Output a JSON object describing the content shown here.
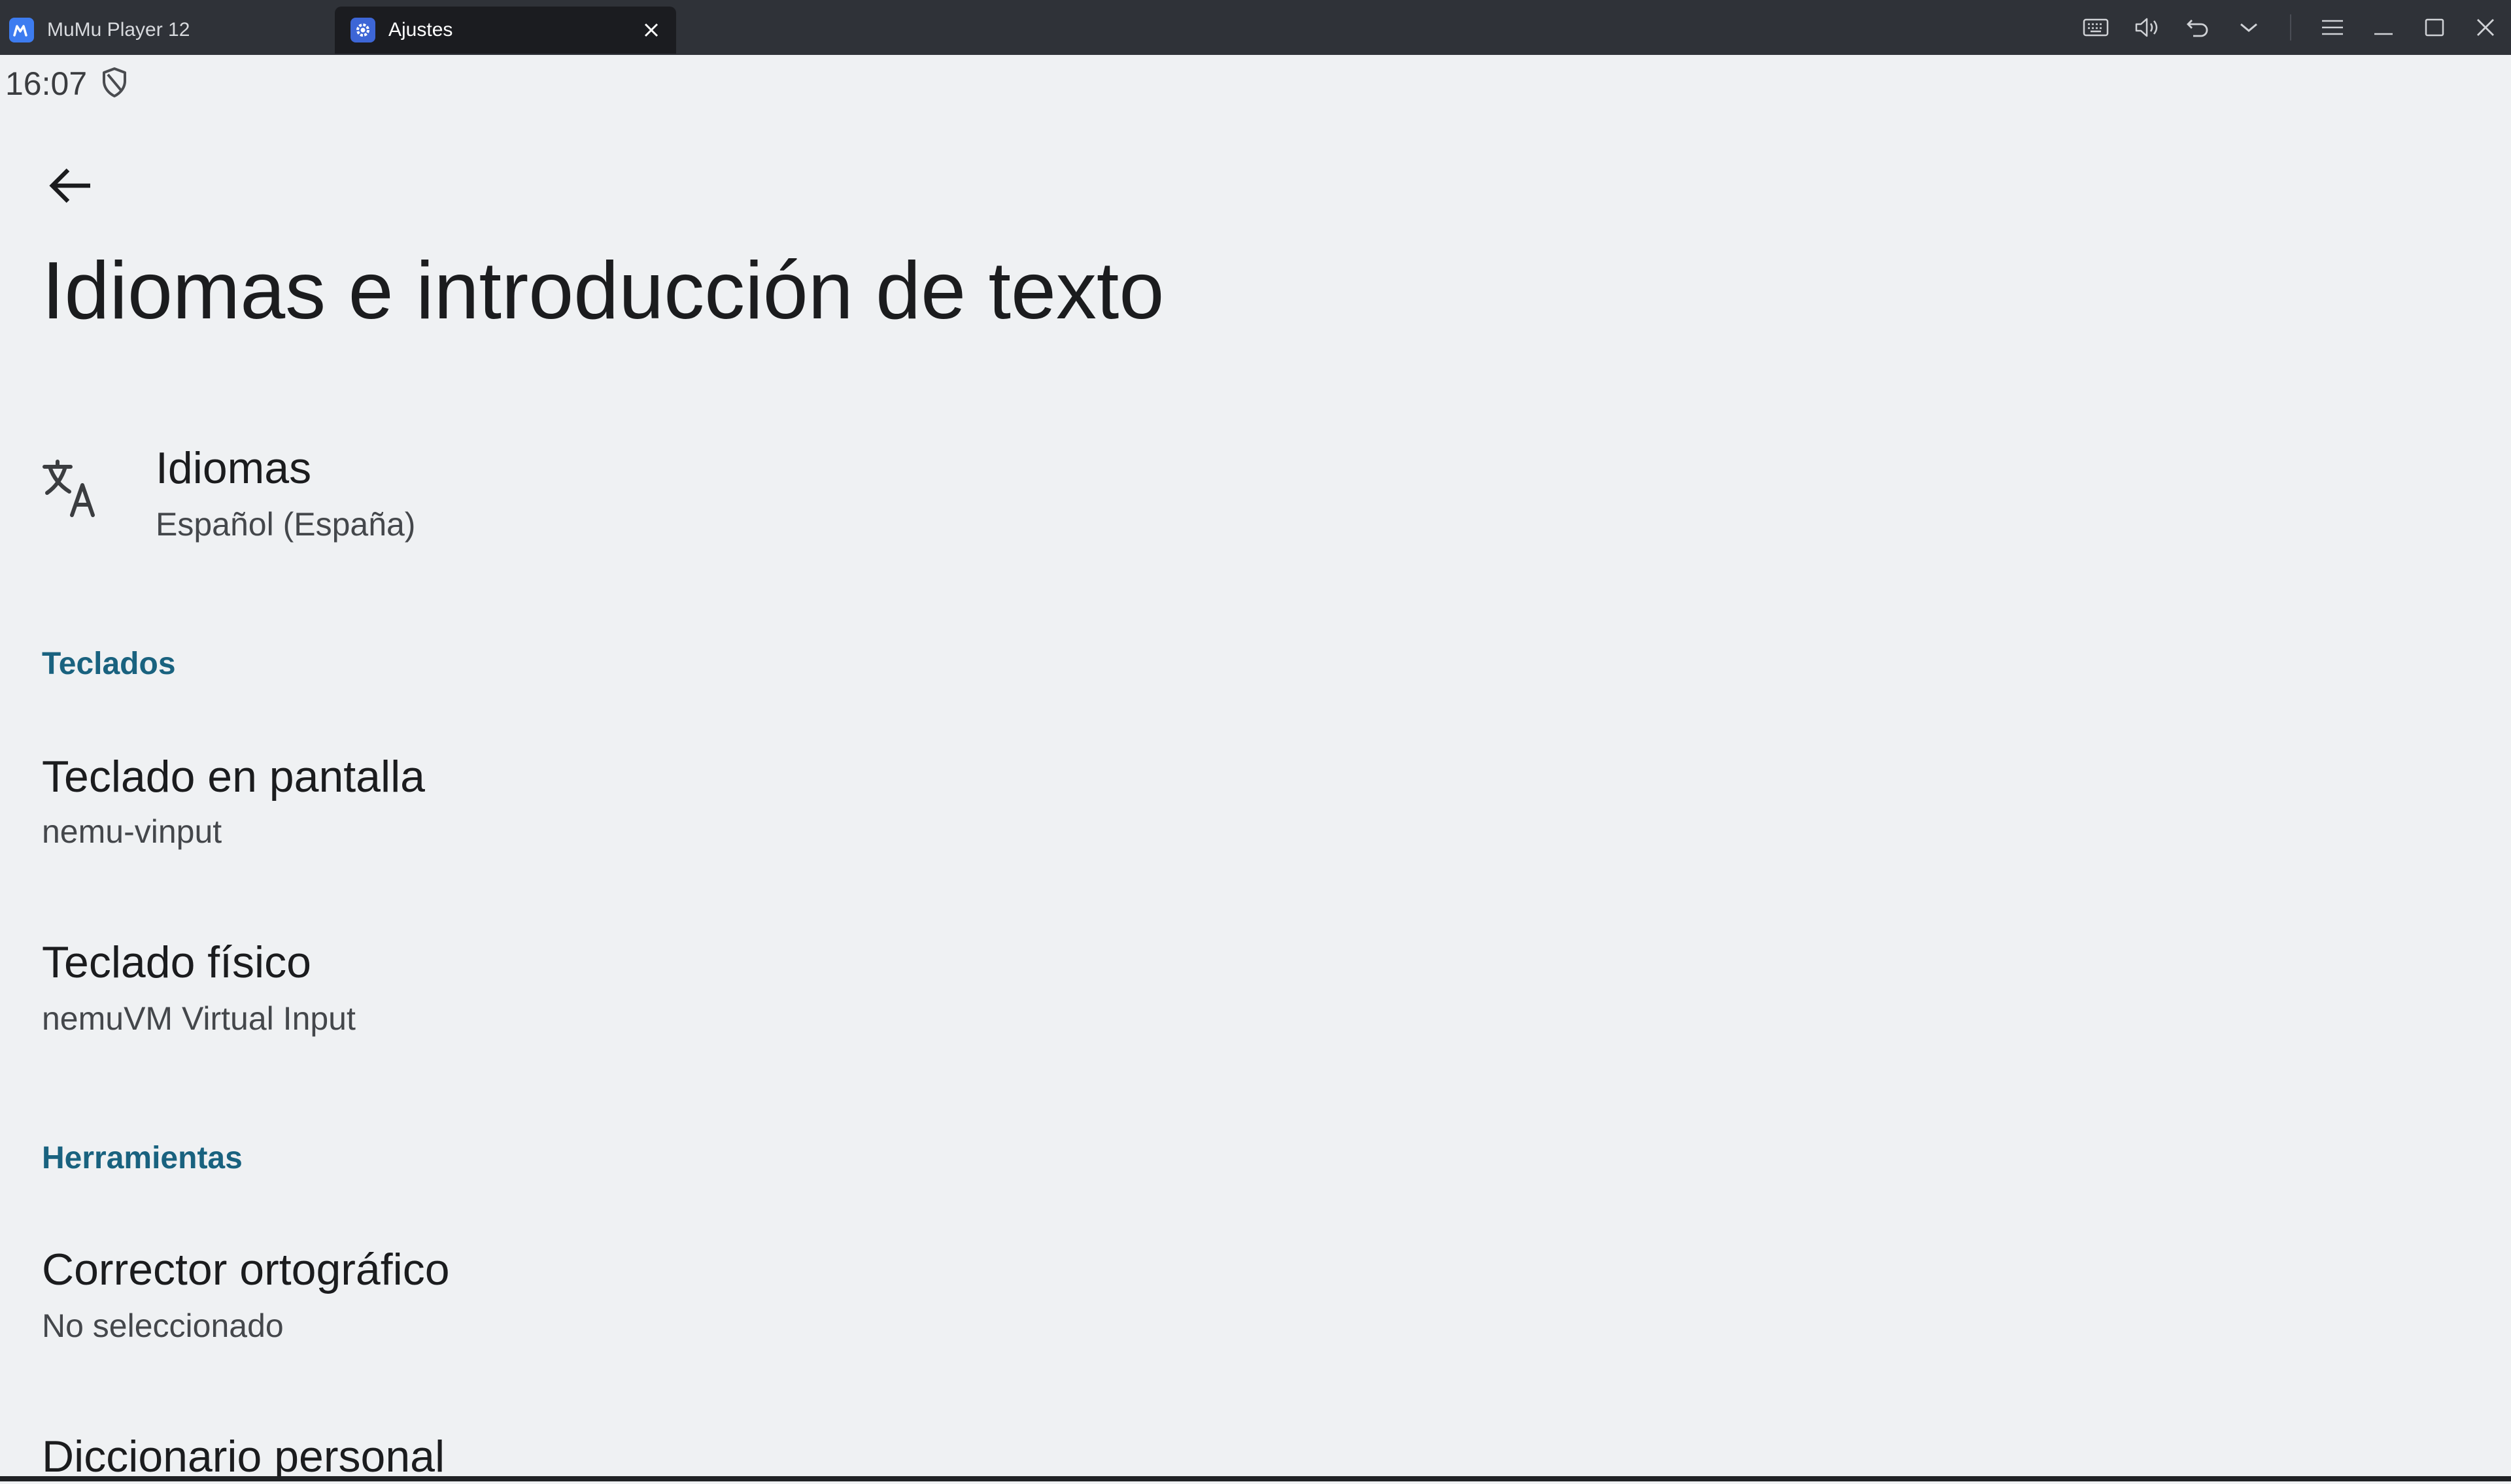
{
  "window": {
    "tabs": [
      {
        "label": "MuMu Player 12",
        "icon": "mumu-logo-icon",
        "active": false
      },
      {
        "label": "Ajustes",
        "icon": "settings-gear-icon",
        "active": true
      }
    ],
    "toolbar_icons": [
      "keyboard-icon",
      "volume-icon",
      "rotate-undo-icon",
      "chevron-down-icon",
      "menu-icon",
      "minimize-icon",
      "maximize-icon",
      "close-icon"
    ]
  },
  "status_bar": {
    "time": "16:07"
  },
  "page": {
    "title": "Idiomas e introducción de texto"
  },
  "items": {
    "languages": {
      "title": "Idiomas",
      "subtitle": "Español (España)"
    },
    "keyboards_header": "Teclados",
    "onscreen_keyboard": {
      "title": "Teclado en pantalla",
      "subtitle": "nemu-vinput"
    },
    "physical_keyboard": {
      "title": "Teclado físico",
      "subtitle": "nemuVM Virtual Input"
    },
    "tools_header": "Herramientas",
    "spell_checker": {
      "title": "Corrector ortográfico",
      "subtitle": "No seleccionado"
    },
    "personal_dictionary": {
      "title": "Diccionario personal"
    }
  },
  "colors": {
    "accent": "#19627f",
    "background": "#eff1f3",
    "titlebar": "#2f3238"
  }
}
